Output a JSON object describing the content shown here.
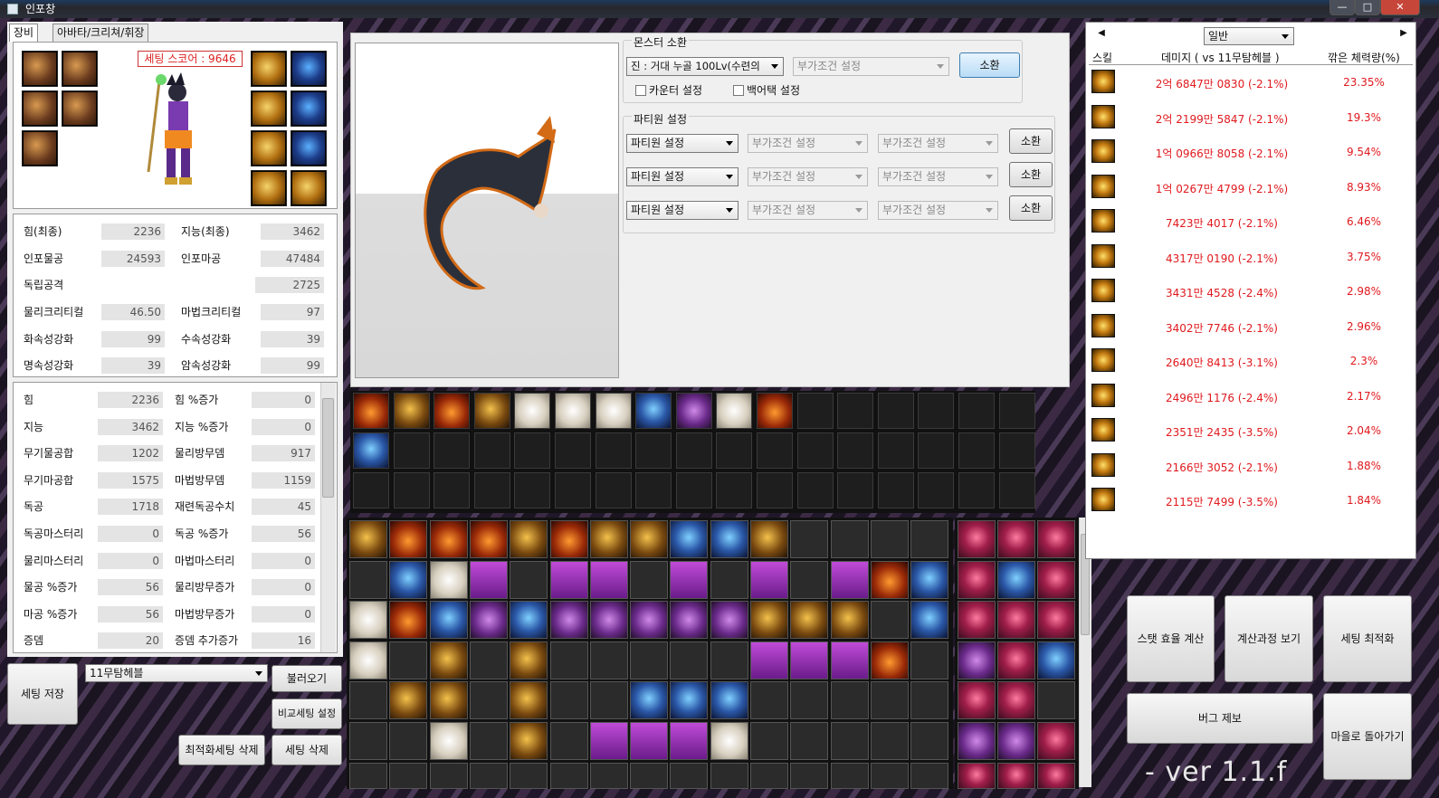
{
  "window": {
    "title": "인포창",
    "min": "—",
    "max": "□",
    "close": "✕"
  },
  "tabs": [
    {
      "label": "장비"
    },
    {
      "label": "아바타/크리쳐/휘장"
    }
  ],
  "equipment": {
    "score_label": "세팅 스코어 : 9646"
  },
  "stats_summary": [
    {
      "l1": "힘(최종)",
      "v1": "2236",
      "l2": "지능(최종)",
      "v2": "3462"
    },
    {
      "l1": "인포물공",
      "v1": "24593",
      "l2": "인포마공",
      "v2": "47484"
    },
    {
      "l1": "독립공격",
      "v1": "",
      "l2": "",
      "v2": "2725"
    },
    {
      "l1": "물리크리티컬",
      "v1": "46.50",
      "l2": "마법크리티컬",
      "v2": "97"
    },
    {
      "l1": "화속성강화",
      "v1": "99",
      "l2": "수속성강화",
      "v2": "39"
    },
    {
      "l1": "명속성강화",
      "v1": "39",
      "l2": "암속성강화",
      "v2": "99"
    }
  ],
  "stats_detail": [
    {
      "l1": "힘",
      "v1": "2236",
      "l2": "힘 %증가",
      "v2": "0"
    },
    {
      "l1": "지능",
      "v1": "3462",
      "l2": "지능 %증가",
      "v2": "0"
    },
    {
      "l1": "무기물공합",
      "v1": "1202",
      "l2": "물리방무뎀",
      "v2": "917"
    },
    {
      "l1": "무기마공합",
      "v1": "1575",
      "l2": "마법방무뎀",
      "v2": "1159"
    },
    {
      "l1": "독공",
      "v1": "1718",
      "l2": "재련독공수치",
      "v2": "45"
    },
    {
      "l1": "독공마스터리",
      "v1": "0",
      "l2": "독공 %증가",
      "v2": "56"
    },
    {
      "l1": "물리마스터리",
      "v1": "0",
      "l2": "마법마스터리",
      "v2": "0"
    },
    {
      "l1": "물공 %증가",
      "v1": "56",
      "l2": "물리방무증가",
      "v2": "0"
    },
    {
      "l1": "마공 %증가",
      "v1": "56",
      "l2": "마법방무증가",
      "v2": "0"
    },
    {
      "l1": "증뎀",
      "v1": "20",
      "l2": "증뎀 추가증가",
      "v2": "16"
    }
  ],
  "bottom_left": {
    "save_button": "세팅 저장",
    "preset_select": "11무탐헤블",
    "load_button": "불러오기",
    "compare_button": "비교세팅 설정",
    "delete_opt_button": "최적화세팅 삭제",
    "delete_button": "세팅 삭제"
  },
  "monster": {
    "section_title": "몬스터 소환",
    "monster_select": "진 : 거대 누골 100Lv(수련의",
    "condition_placeholder": "부가조건 설정",
    "summon_button": "소환",
    "counter_label": "카운터 설정",
    "backattack_label": "백어택 설정"
  },
  "party": {
    "section_title": "파티원 설정",
    "rows": [
      {
        "member": "파티원 설정",
        "cond1": "부가조건 설정",
        "cond2": "부가조건 설정",
        "button": "소환"
      },
      {
        "member": "파티원 설정",
        "cond1": "부가조건 설정",
        "cond2": "부가조건 설정",
        "button": "소환"
      },
      {
        "member": "파티원 설정",
        "cond1": "부가조건 설정",
        "cond2": "부가조건 설정",
        "button": "소환"
      }
    ]
  },
  "damage_panel": {
    "mode_select": "일반",
    "col_skill": "스킬",
    "col_damage": "데미지 ( vs 11무탐헤블 )",
    "col_hp": "깎은 체력량(%)",
    "rows": [
      {
        "damage": "2억 6847만 0830 (-2.1%)",
        "hp": "23.35%"
      },
      {
        "damage": "2억 2199만 5847 (-2.1%)",
        "hp": "19.3%"
      },
      {
        "damage": "1억 0966만 8058 (-2.1%)",
        "hp": "9.54%"
      },
      {
        "damage": "1억 0267만 4799 (-2.1%)",
        "hp": "8.93%"
      },
      {
        "damage": "7423만 4017 (-2.1%)",
        "hp": "6.46%"
      },
      {
        "damage": "4317만 0190 (-2.1%)",
        "hp": "3.75%"
      },
      {
        "damage": "3431만 4528 (-2.4%)",
        "hp": "2.98%"
      },
      {
        "damage": "3402만 7746 (-2.1%)",
        "hp": "2.96%"
      },
      {
        "damage": "2640만 8413 (-3.1%)",
        "hp": "2.3%"
      },
      {
        "damage": "2496만 1176 (-2.4%)",
        "hp": "2.17%"
      },
      {
        "damage": "2351만 2435 (-3.5%)",
        "hp": "2.04%"
      },
      {
        "damage": "2166만 3052 (-2.1%)",
        "hp": "1.88%"
      },
      {
        "damage": "2115만 7499 (-3.5%)",
        "hp": "1.84%"
      }
    ]
  },
  "actions": {
    "stat_eff": "스탯 효율 계산",
    "calc_process": "계산과정 보기",
    "optimize": "세팅 최적화",
    "bug_report": "버그 제보",
    "back_town": "마을로 돌아가기"
  },
  "version": "- ver 1.1.f",
  "colors": {
    "damage_red": "#e0191e",
    "score_red": "#d22222"
  }
}
